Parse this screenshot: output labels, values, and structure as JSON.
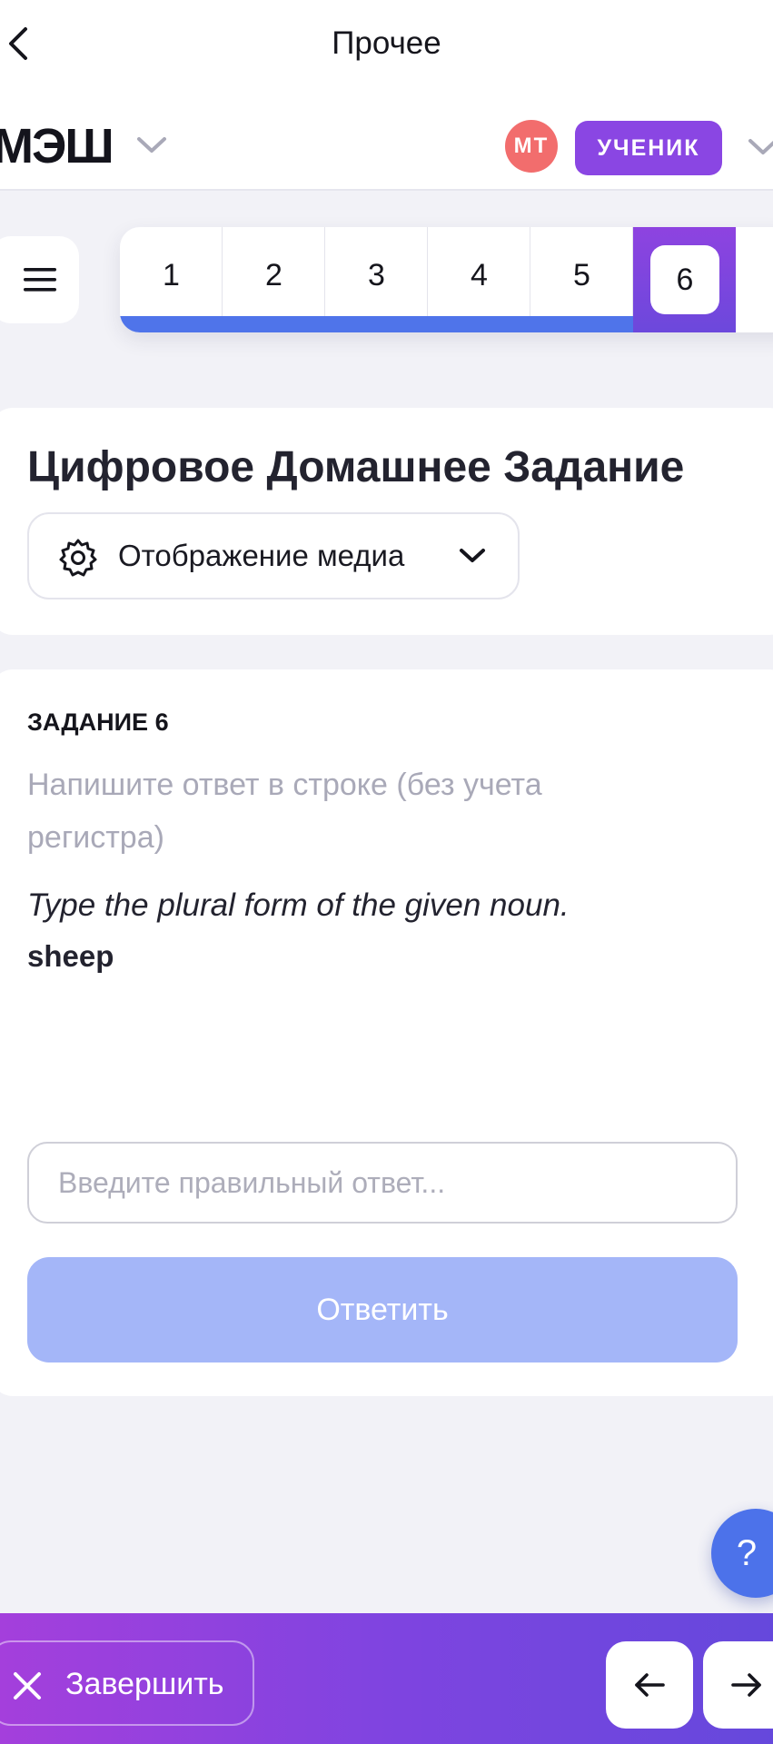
{
  "topbar": {
    "title": "Прочее"
  },
  "header": {
    "logo": "МЭШ",
    "avatar_initials": "МТ",
    "role": "УЧЕНИК"
  },
  "question_nav": {
    "items": [
      {
        "label": "1",
        "state": "answered"
      },
      {
        "label": "2",
        "state": "answered"
      },
      {
        "label": "3",
        "state": "answered"
      },
      {
        "label": "4",
        "state": "answered"
      },
      {
        "label": "5",
        "state": "answered"
      },
      {
        "label": "6",
        "state": "current"
      }
    ]
  },
  "homework": {
    "title": "Цифровое Домашнее Задание",
    "media_display": "Отображение медиа"
  },
  "task": {
    "label": "ЗАДАНИЕ 6",
    "instruction": "Напишите ответ в строке (без учета регистра)",
    "prompt": "Type the plural form of the given noun.",
    "word": "sheep",
    "answer_value": "",
    "answer_placeholder": "Введите правильный ответ...",
    "submit_label": "Ответить"
  },
  "help": {
    "label": "?"
  },
  "bottom": {
    "finish_label": "Завершить"
  },
  "colors": {
    "accent_purple": "#8a46e3",
    "accent_blue": "#4f74ea",
    "avatar_red": "#f26d6d",
    "submit_disabled": "#a4b6f8"
  }
}
